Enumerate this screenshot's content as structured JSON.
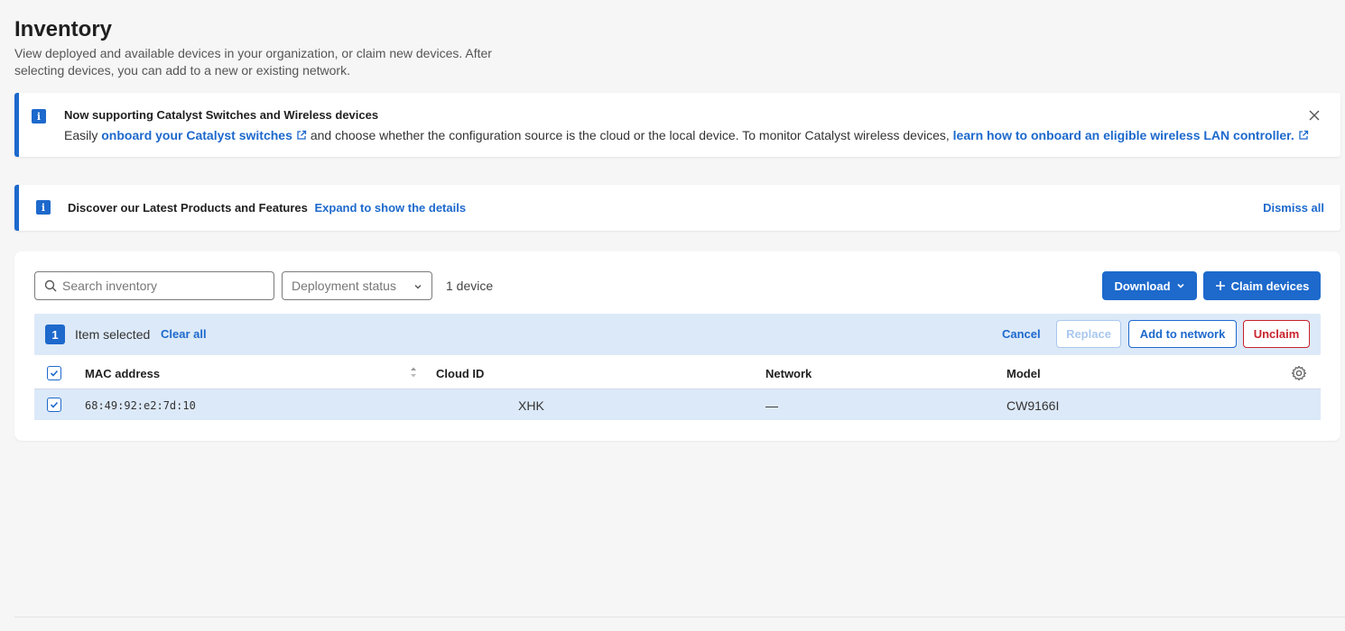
{
  "header": {
    "title": "Inventory",
    "description": "View deployed and available devices in your organization, or claim new devices. After selecting devices, you can add to a new or existing network."
  },
  "banner_catalyst": {
    "title": "Now supporting Catalyst Switches and Wireless devices",
    "text_prefix": "Easily",
    "link1": "onboard your Catalyst switches",
    "text_middle": "and choose whether the configuration source is the cloud or the local device. To monitor Catalyst wireless devices,",
    "link2": "learn how to onboard an eligible wireless LAN controller.",
    "icon": "info-icon"
  },
  "banner_discover": {
    "title": "Discover our Latest Products and Features",
    "link": "Expand to show the details",
    "dismiss": "Dismiss all"
  },
  "toolbar": {
    "search_placeholder": "Search inventory",
    "deployment_status": "Deployment status",
    "device_count": "1 device",
    "download_label": "Download",
    "claim_label": "Claim devices"
  },
  "selection": {
    "count": "1",
    "label": "Item selected",
    "clear_all": "Clear all",
    "cancel": "Cancel",
    "replace": "Replace",
    "add_to_network": "Add to network",
    "unclaim": "Unclaim"
  },
  "table": {
    "columns": [
      "MAC address",
      "Cloud ID",
      "Network",
      "Model"
    ],
    "rows": [
      {
        "mac": "68:49:92:e2:7d:10",
        "cloud_id": "XHK",
        "network": "—",
        "model": "CW9166I",
        "selected": true
      }
    ]
  },
  "colors": {
    "accent": "#1d69cc",
    "danger": "#c8232c",
    "selection_bg": "#dce9f8"
  }
}
